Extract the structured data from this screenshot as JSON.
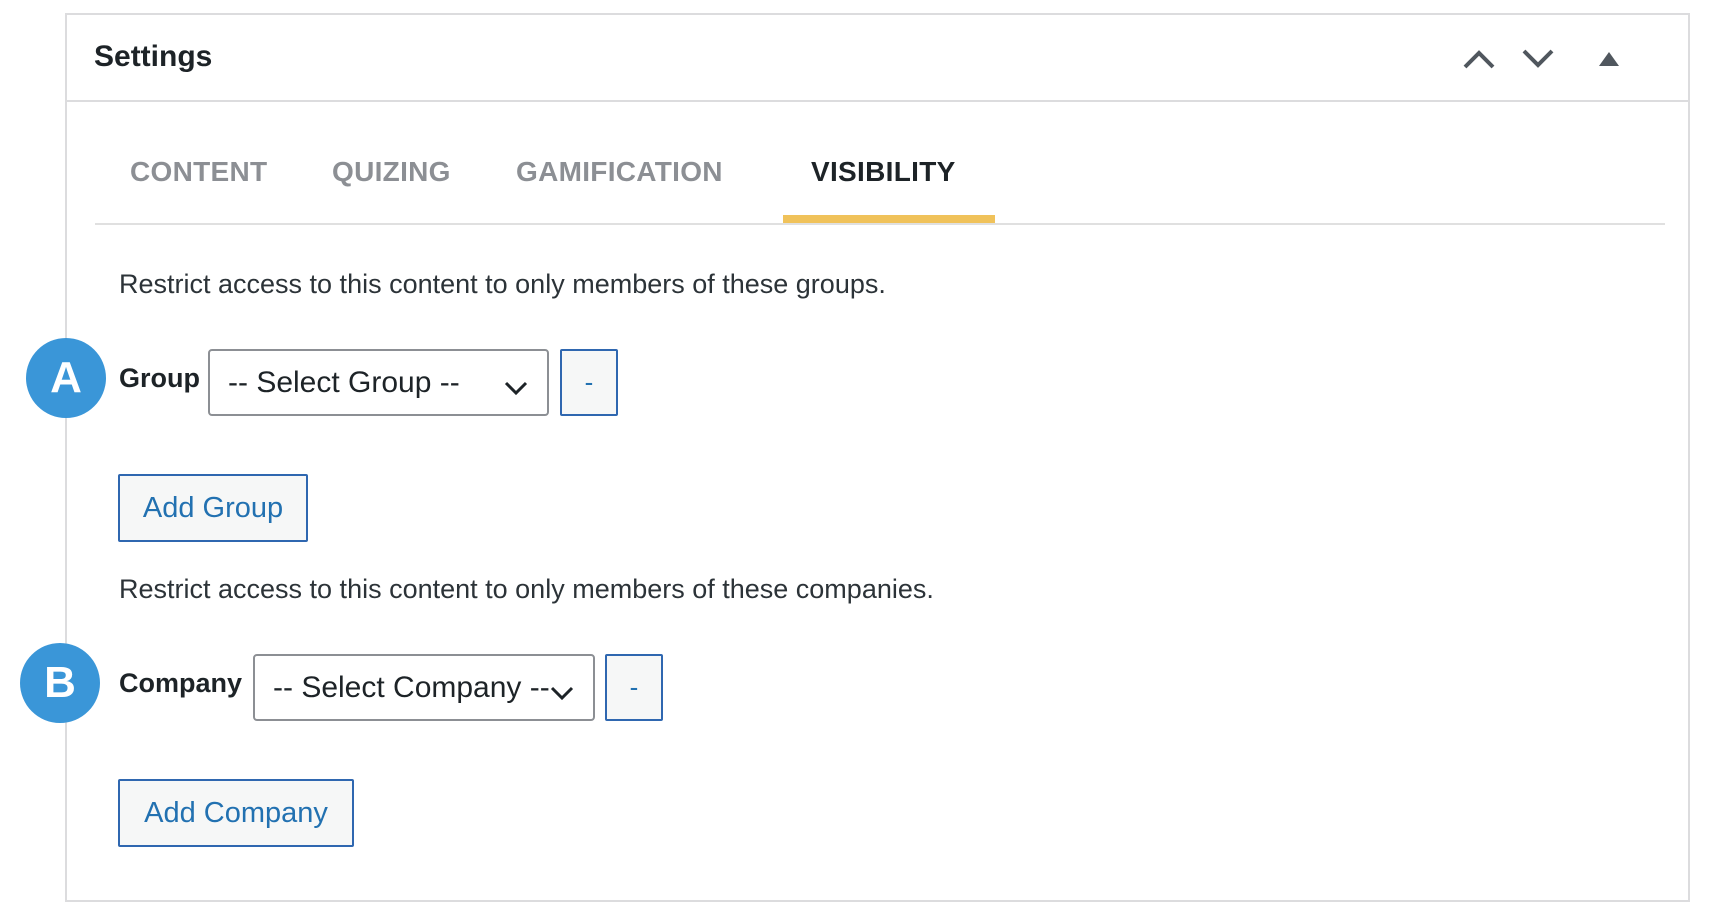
{
  "panel": {
    "title": "Settings",
    "header_icons": [
      "chevron-up-icon",
      "chevron-down-icon",
      "triangle-up-icon"
    ]
  },
  "tabs": [
    {
      "label": "CONTENT",
      "active": false
    },
    {
      "label": "QUIZING",
      "active": false
    },
    {
      "label": "GAMIFICATION",
      "active": false
    },
    {
      "label": "VISIBILITY",
      "active": true
    }
  ],
  "groups_section": {
    "description": "Restrict access to this content to only members of these groups.",
    "label": "Group",
    "select_value": "-- Select Group --",
    "remove_label": "-",
    "add_label": "Add Group"
  },
  "companies_section": {
    "description": "Restrict access to this content to only members of these companies.",
    "label": "Company",
    "select_value": "-- Select Company --",
    "remove_label": "-",
    "add_label": "Add Company"
  },
  "markers": {
    "a": "A",
    "b": "B"
  },
  "colors": {
    "accent_tab_underline": "#f0c25a",
    "button_blue": "#2271b1",
    "marker_blue": "#3a96d8"
  }
}
